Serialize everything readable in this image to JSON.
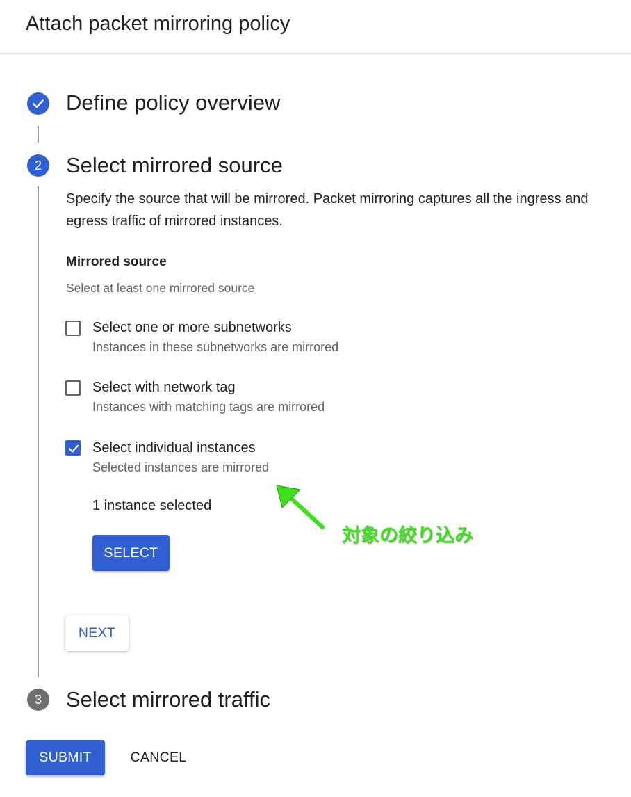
{
  "header": {
    "title": "Attach packet mirroring policy"
  },
  "steps": [
    {
      "index": "1",
      "title": "Define policy overview",
      "state": "completed"
    },
    {
      "index": "2",
      "title": "Select mirrored source",
      "state": "active"
    },
    {
      "index": "3",
      "title": "Select mirrored traffic",
      "state": "pending"
    }
  ],
  "source": {
    "description": "Specify the source that will be mirrored. Packet mirroring captures all the ingress and egress traffic of mirrored instances.",
    "label": "Mirrored source",
    "help": "Select at least one mirrored source",
    "options": [
      {
        "label": "Select one or more subnetworks",
        "help": "Instances in these subnetworks are mirrored",
        "checked": false
      },
      {
        "label": "Select with network tag",
        "help": "Instances with matching tags are mirrored",
        "checked": false
      },
      {
        "label": "Select individual instances",
        "help": "Selected instances are mirrored",
        "checked": true
      }
    ],
    "instances_selected": "1 instance selected",
    "select_button": "SELECT",
    "next_button": "NEXT"
  },
  "footer": {
    "submit_button": "SUBMIT",
    "cancel_button": "CANCEL"
  },
  "annotation": {
    "text": "対象の絞り込み",
    "color": "#3ee01e"
  },
  "colors": {
    "primary": "#2f5fd0",
    "pending": "#6f6f6f"
  },
  "icons": {
    "completed_step": "check-icon",
    "checkbox_checked": "check-icon",
    "annotation": "arrow-icon"
  }
}
